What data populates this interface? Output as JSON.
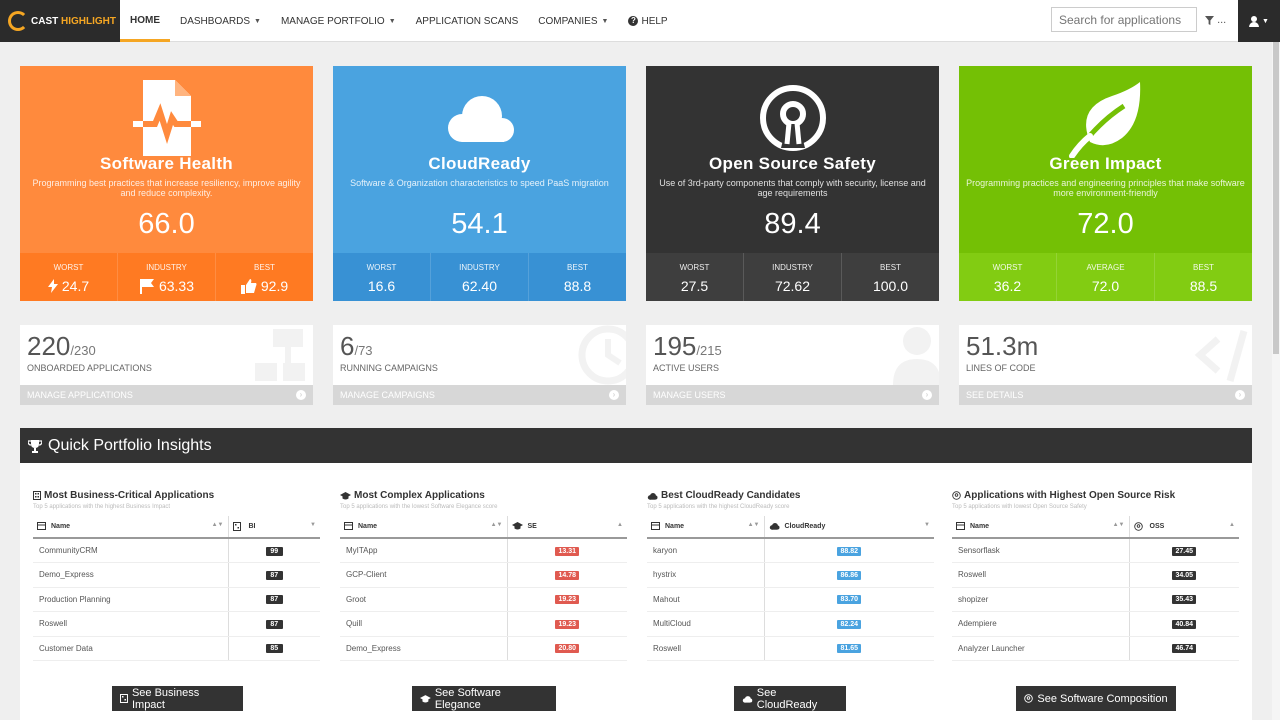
{
  "nav": {
    "logo_cast": "CAST",
    "logo_highlight": "HIGHLIGHT",
    "items": [
      {
        "label": "HOME",
        "dropdown": false
      },
      {
        "label": "DASHBOARDS",
        "dropdown": true
      },
      {
        "label": "MANAGE PORTFOLIO",
        "dropdown": true
      },
      {
        "label": "APPLICATION SCANS",
        "dropdown": false
      },
      {
        "label": "COMPANIES",
        "dropdown": true
      },
      {
        "label": "HELP",
        "dropdown": false
      }
    ],
    "search_placeholder": "Search for applications",
    "filter_label": "..."
  },
  "cards": [
    {
      "title": "Software Health",
      "desc": "Programming best practices that increase resiliency, improve agility and reduce complexity.",
      "score": "66.0",
      "stats": [
        {
          "label": "WORST",
          "value": "24.7"
        },
        {
          "label": "INDUSTRY",
          "value": "63.33"
        },
        {
          "label": "BEST",
          "value": "92.9"
        }
      ]
    },
    {
      "title": "CloudReady",
      "desc": "Software & Organization characteristics to speed PaaS migration",
      "score": "54.1",
      "stats": [
        {
          "label": "WORST",
          "value": "16.6"
        },
        {
          "label": "INDUSTRY",
          "value": "62.40"
        },
        {
          "label": "BEST",
          "value": "88.8"
        }
      ]
    },
    {
      "title": "Open Source Safety",
      "desc": "Use of 3rd-party components that comply with security, license and age requirements",
      "score": "89.4",
      "stats": [
        {
          "label": "WORST",
          "value": "27.5"
        },
        {
          "label": "INDUSTRY",
          "value": "72.62"
        },
        {
          "label": "BEST",
          "value": "100.0"
        }
      ]
    },
    {
      "title": "Green Impact",
      "desc": "Programming practices and engineering principles that make software more environment-friendly",
      "score": "72.0",
      "stats": [
        {
          "label": "WORST",
          "value": "36.2"
        },
        {
          "label": "AVERAGE",
          "value": "72.0"
        },
        {
          "label": "BEST",
          "value": "88.5"
        }
      ]
    }
  ],
  "kpis": [
    {
      "value": "220",
      "total": "/230",
      "label": "ONBOARDED APPLICATIONS",
      "link": "MANAGE APPLICATIONS"
    },
    {
      "value": "6",
      "total": "/73",
      "label": "RUNNING CAMPAIGNS",
      "link": "MANAGE CAMPAIGNS"
    },
    {
      "value": "195",
      "total": "/215",
      "label": "ACTIVE USERS",
      "link": "MANAGE USERS"
    },
    {
      "value": "51.3m",
      "total": "",
      "label": "LINES OF CODE",
      "link": "SEE DETAILS"
    }
  ],
  "insights": {
    "title": "Quick Portfolio Insights",
    "panels": [
      {
        "title": "Most Business-Critical Applications",
        "sub": "Top 5 applications with the highest Business Impact",
        "col_name": "Name",
        "col_val": "BI",
        "button": "See Business Impact",
        "rows": [
          {
            "name": "CommunityCRM",
            "val": "99"
          },
          {
            "name": "Demo_Express",
            "val": "87"
          },
          {
            "name": "Production Planning",
            "val": "87"
          },
          {
            "name": "Roswell",
            "val": "87"
          },
          {
            "name": "Customer Data",
            "val": "85"
          }
        ]
      },
      {
        "title": "Most Complex Applications",
        "sub": "Top 5 applications with the lowest Software Elegance score",
        "col_name": "Name",
        "col_val": "SE",
        "button": "See Software Elegance",
        "rows": [
          {
            "name": "MyITApp",
            "val": "13.31"
          },
          {
            "name": "GCP-Client",
            "val": "14.78"
          },
          {
            "name": "Groot",
            "val": "19.23"
          },
          {
            "name": "Quill",
            "val": "19.23"
          },
          {
            "name": "Demo_Express",
            "val": "20.80"
          }
        ]
      },
      {
        "title": "Best CloudReady Candidates",
        "sub": "Top 5 applications with the highest CloudReady score",
        "col_name": "Name",
        "col_val": "CloudReady",
        "button": "See CloudReady",
        "rows": [
          {
            "name": "karyon",
            "val": "88.82"
          },
          {
            "name": "hystrix",
            "val": "86.86"
          },
          {
            "name": "Mahout",
            "val": "83.70"
          },
          {
            "name": "MultiCloud",
            "val": "82.24"
          },
          {
            "name": "Roswell",
            "val": "81.65"
          }
        ]
      },
      {
        "title": "Applications with Highest Open Source Risk",
        "sub": "Top 5 applications with lowest Open Source Safety",
        "col_name": "Name",
        "col_val": "OSS",
        "button": "See Software Composition",
        "rows": [
          {
            "name": "Sensorflask",
            "val": "27.45"
          },
          {
            "name": "Roswell",
            "val": "34.05"
          },
          {
            "name": "shopizer",
            "val": "35.43"
          },
          {
            "name": "Adempiere",
            "val": "40.84"
          },
          {
            "name": "Analyzer Launcher",
            "val": "46.74"
          }
        ]
      }
    ]
  },
  "colors": {
    "health": "#ff8a3d",
    "cloud": "#4aa3e0",
    "oss": "#333333",
    "green": "#74c005",
    "accent": "#f5a623"
  }
}
